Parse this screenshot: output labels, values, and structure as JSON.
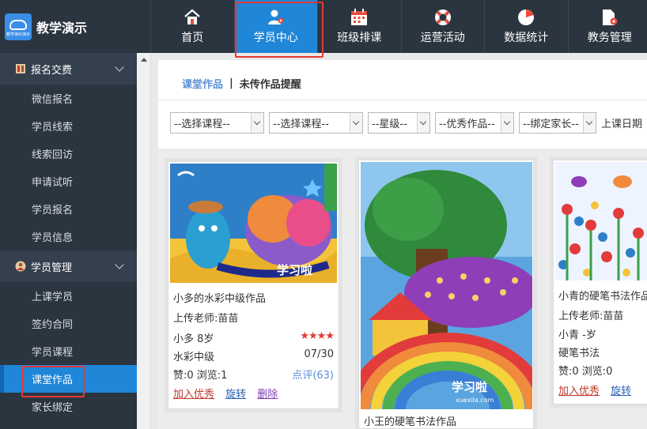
{
  "brand": {
    "title": "教学演示",
    "logo_caption": "教学演示演示"
  },
  "nav": [
    {
      "label": "首页",
      "icon": "home-icon"
    },
    {
      "label": "学员中心",
      "icon": "user-gear-icon",
      "active": true
    },
    {
      "label": "班级排课",
      "icon": "calendar-icon"
    },
    {
      "label": "运营活动",
      "icon": "lifebuoy-icon"
    },
    {
      "label": "数据统计",
      "icon": "pie-chart-icon"
    },
    {
      "label": "教务管理",
      "icon": "folder-gear-icon"
    }
  ],
  "sidebar": {
    "group1": {
      "label": "报名交费",
      "icon": "ledger-icon"
    },
    "group1_items": [
      "微信报名",
      "学员线索",
      "线索回访",
      "申请试听",
      "学员报名",
      "学员信息"
    ],
    "group2": {
      "label": "学员管理",
      "icon": "person-badge-icon"
    },
    "group2_items": [
      "上课学员",
      "签约合同",
      "学员课程",
      "课堂作品",
      "家长绑定"
    ],
    "active_item": "课堂作品"
  },
  "tabs": {
    "first": "课堂作品",
    "separator": "|",
    "second": "未传作品提醒"
  },
  "filters": {
    "course1": "--选择课程--",
    "course2": "--选择课程--",
    "star": "--星级--",
    "excellent": "--优秀作品--",
    "parent": "--绑定家长--",
    "date_label": "上课日期"
  },
  "colors": {
    "topbar": "#2b3540",
    "active": "#1f86d8",
    "highlight_border": "#e53935"
  },
  "cards": {
    "c1": {
      "title": "小多的水彩中级作品",
      "teacher": "上传老师:苗苗",
      "student": "小多 8岁",
      "stars": "★★★★",
      "course": "水彩中级",
      "date": "07/30",
      "stats": "赞:0  浏览:1",
      "review": "点评(63)",
      "actions": {
        "fav": "加入优秀",
        "rotate": "旋转",
        "delete": "删除"
      },
      "watermark": "学习啦"
    },
    "c2": {
      "title": "小王的硬笔书法作品",
      "watermark": "学习啦",
      "watermark_url": "xuexila.com"
    },
    "c3": {
      "title": "小青的硬笔书法作品",
      "teacher": "上传老师:苗苗",
      "student": "小青 -岁",
      "course": "硬笔书法",
      "stats": "赞:0  浏览:0",
      "actions": {
        "fav": "加入优秀",
        "rotate": "旋转"
      }
    }
  }
}
